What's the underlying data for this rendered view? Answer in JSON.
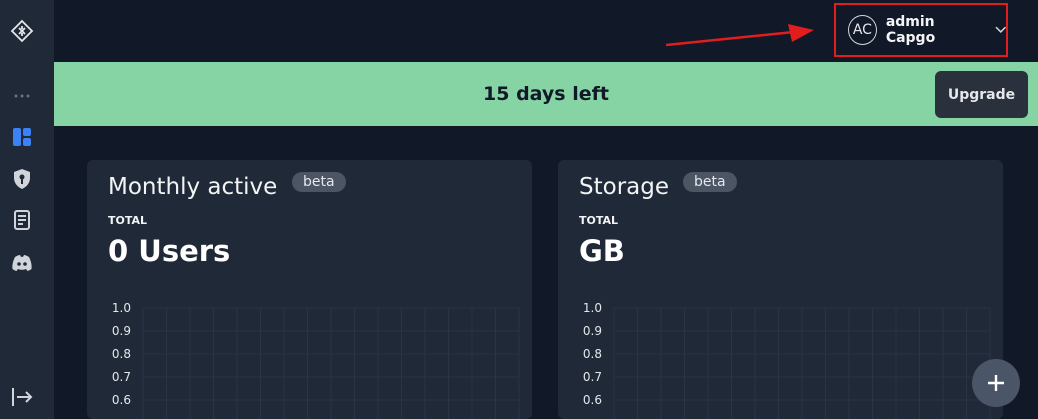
{
  "user": {
    "initials": "AC",
    "name": "admin Capgo"
  },
  "banner": {
    "text": "15 days left",
    "upgrade_label": "Upgrade"
  },
  "cards": [
    {
      "title": "Monthly active",
      "badge": "beta",
      "total_label": "TOTAL",
      "value": "0 Users"
    },
    {
      "title": "Storage",
      "badge": "beta",
      "total_label": "TOTAL",
      "value": "GB"
    }
  ],
  "chart_ticks": [
    "1.0",
    "0.9",
    "0.8",
    "0.7",
    "0.6"
  ],
  "chart_data": [
    {
      "type": "line",
      "ylim": [
        0.6,
        1.0
      ],
      "y_ticks": [
        1.0,
        0.9,
        0.8,
        0.7,
        0.6
      ],
      "series": []
    },
    {
      "type": "line",
      "ylim": [
        0.6,
        1.0
      ],
      "y_ticks": [
        1.0,
        0.9,
        0.8,
        0.7,
        0.6
      ],
      "series": []
    }
  ],
  "colors": {
    "background": "#111827",
    "sidebar": "#1f2937",
    "banner": "#86d4a4",
    "accent": "#3b82f6",
    "highlight": "#e11d1d"
  },
  "icons": [
    "logo-icon",
    "more-icon",
    "dashboard-icon",
    "shield-key-icon",
    "document-icon",
    "discord-icon",
    "logout-icon",
    "chevron-down-icon",
    "plus-icon"
  ]
}
